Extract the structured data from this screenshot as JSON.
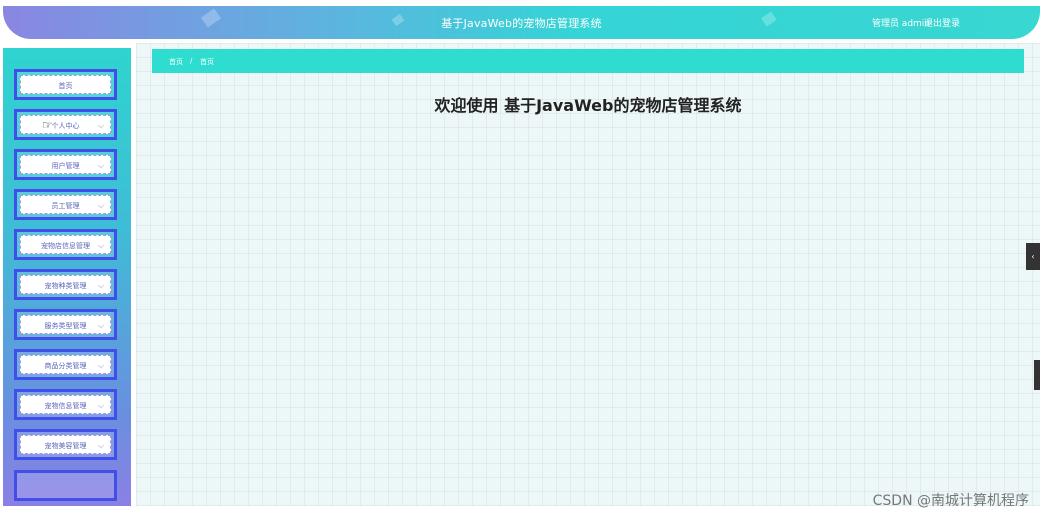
{
  "header": {
    "title": "基于JavaWeb的宠物店管理系统",
    "user_label": "管理员 admin",
    "logout_label": "退出登录"
  },
  "sidebar": {
    "items": [
      {
        "label": "首页",
        "has_chevron": false
      },
      {
        "label": "个人中心",
        "has_chevron": true
      },
      {
        "label": "用户管理",
        "has_chevron": true
      },
      {
        "label": "员工管理",
        "has_chevron": true
      },
      {
        "label": "宠物店信息管理",
        "has_chevron": true
      },
      {
        "label": "宠物种类管理",
        "has_chevron": true
      },
      {
        "label": "服务类型管理",
        "has_chevron": true
      },
      {
        "label": "商品分类管理",
        "has_chevron": true
      },
      {
        "label": "宠物信息管理",
        "has_chevron": true
      },
      {
        "label": "宠物美容管理",
        "has_chevron": true
      }
    ]
  },
  "breadcrumb": {
    "home": "首页",
    "separator": "/",
    "current": "首页"
  },
  "main": {
    "welcome": "欢迎使用 基于JavaWeb的宠物店管理系统"
  },
  "watermark": "CSDN @南城计算机程序",
  "icons": {
    "chevron": "chevron-down-icon",
    "collapse": "chevron-left-icon"
  }
}
